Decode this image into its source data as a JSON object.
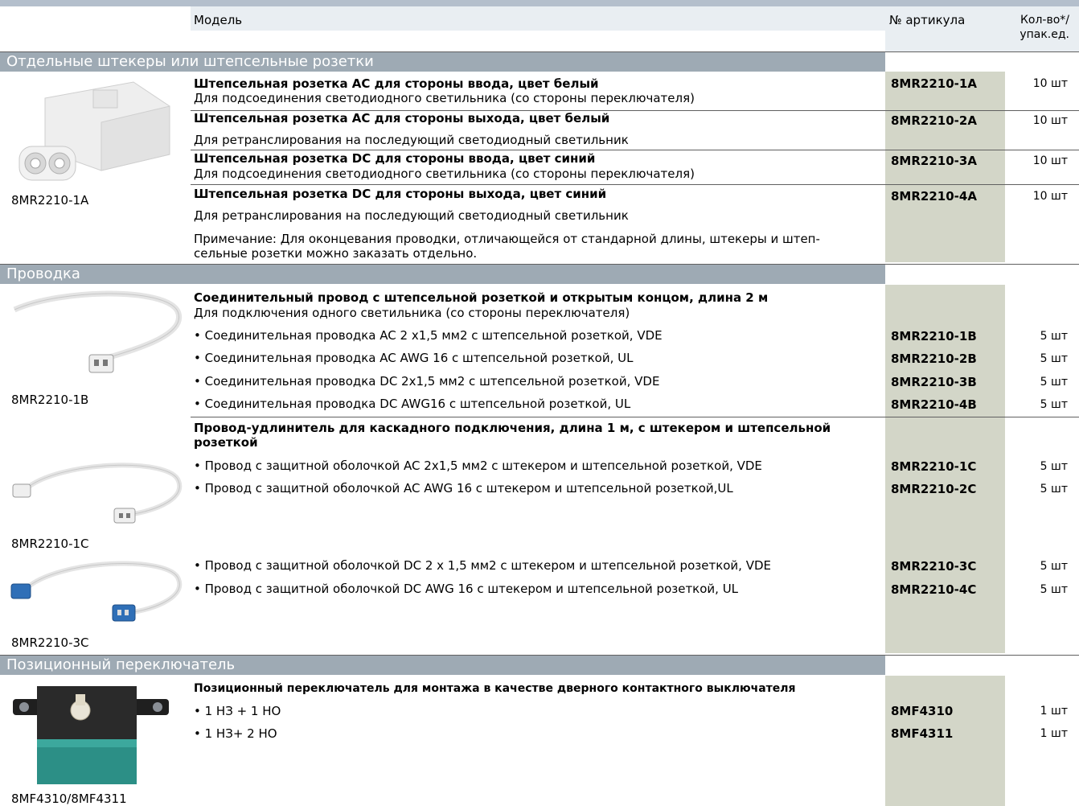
{
  "header": {
    "model": "Модель",
    "article": "№ артикула",
    "qty": "Кол-во*/\nупак.ед."
  },
  "sections": {
    "s1": "Отдельные штекеры или штепсельные розетки",
    "s2": "Проводка",
    "s3": "Позиционный переключатель"
  },
  "rows": {
    "r1_title": "Штепсельная розетка AC для стороны ввода, цвет белый",
    "r1_desc": "Для подсоединения светодиодного светильника (со стороны переключателя)",
    "r1_art": "8MR2210-1A",
    "r1_qty": "10 шт",
    "r2_title": "Штепсельная розетка AC для стороны выхода, цвет белый",
    "r2_desc": "Для ретранслирования на последующий светодиодный светильник",
    "r2_art": "8MR2210-2A",
    "r2_qty": "10 шт",
    "r3_title": "Штепсельная розетка DC для стороны ввода, цвет синий",
    "r3_desc": "Для подсоединения светодиодного светильника (со стороны переключателя)",
    "r3_art": "8MR2210-3A",
    "r3_qty": "10 шт",
    "r4_title": "Штепсельная розетка DC для стороны выхода, цвет синий",
    "r4_desc": "Для ретранслирования на последующий светодиодный светильник",
    "r4_art": "8MR2210-4A",
    "r4_qty": "10 шт",
    "note1": "Примечание: Для оконцевания проводки, отличающейся от стандарной длины, штекеры и штеп-",
    "note2": "сельные розетки можно заказать отдельно.",
    "w_title": "Соединительный провод с штепсельной розеткой и открытым концом, длина 2 м",
    "w_desc": "Для подключения одного светильника (со стороны переключателя)",
    "w1": "• Соединительная проводка AC 2 x1,5 мм2 с штепсельной розеткой, VDE",
    "w1_art": "8MR2210-1B",
    "w1_qty": "5 шт",
    "w2": "• Соединительная проводка AC AWG 16 с штепсельной розеткой, UL",
    "w2_art": "8MR2210-2B",
    "w2_qty": "5 шт",
    "w3": "• Соединительная проводка DC 2x1,5 мм2 с штепсельной розеткой, VDE",
    "w3_art": "8MR2210-3B",
    "w3_qty": "5 шт",
    "w4": "• Соединительная проводка DC AWG16 с штепсельной розеткой, UL",
    "w4_art": "8MR2210-4B",
    "w4_qty": "5 шт",
    "e_title1": "Провод-удлинитель для каскадного подключения, длина 1 м, с штекером и штепсельной",
    "e_title2": "розеткой",
    "e1": "• Провод с защитной оболочкой AC 2x1,5 мм2 с штекером и штепсельной розеткой, VDE",
    "e1_art": "8MR2210-1C",
    "e1_qty": "5 шт",
    "e2": "• Провод с защитной оболочкой AC AWG 16 с штекером и штепсельной розеткой,UL",
    "e2_art": "8MR2210-2C",
    "e2_qty": "5 шт",
    "e3": "• Провод с защитной оболочкой DC  2 x 1,5 мм2 с штекером и штепсельной розеткой, VDE",
    "e3_art": "8MR2210-3C",
    "e3_qty": "5 шт",
    "e4": "• Провод с защитной оболочкой DC  AWG 16 с штекером и штепсельной розеткой, UL",
    "e4_art": "8MR2210-4C",
    "e4_qty": "5 шт",
    "p_title": "Позиционный переключатель для монтажа в качестве дверного контактного выключателя",
    "p1": "• 1 НЗ + 1 НО",
    "p1_art": "8MF4310",
    "p1_qty": "1 шт",
    "p2": "• 1 НЗ+ 2 НО",
    "p2_art": "8MF4311",
    "p2_qty": "1 шт"
  },
  "captions": {
    "c1": "8MR2210-1A",
    "c2": "8MR2210-1B",
    "c3": "8MR2210-1C",
    "c4": "8MR2210-3C",
    "c5": "8MF4310/8MF4311"
  }
}
